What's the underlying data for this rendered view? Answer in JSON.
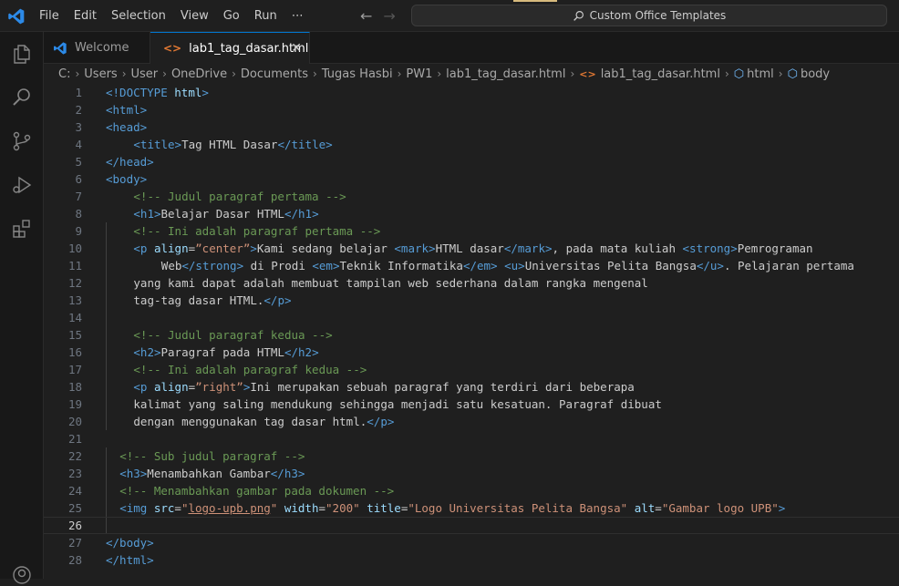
{
  "menu": [
    "File",
    "Edit",
    "Selection",
    "View",
    "Go",
    "Run",
    "⋯"
  ],
  "search": {
    "label": "Custom Office Templates"
  },
  "tabs": [
    {
      "label": "Welcome",
      "icon": "vscode-icon"
    },
    {
      "label": "lab1_tag_dasar.html",
      "icon": "html-file-icon",
      "active": true
    }
  ],
  "breadcrumb": [
    "C:",
    "Users",
    "User",
    "OneDrive",
    "Documents",
    "Tugas Hasbi",
    "PW1",
    "lab1_tag_dasar.html",
    "lab1_tag_dasar.html",
    "html",
    "body"
  ],
  "colors": {
    "tag": "#569cd6",
    "attr": "#9cdcfe",
    "string": "#ce9178",
    "comment": "#6a9955",
    "text": "#cccccc",
    "accent": "#0078d4"
  },
  "current_line": 26,
  "lines": [
    {
      "n": "1",
      "indent": 0,
      "tokens": [
        [
          "t",
          "<!DOCTYPE "
        ],
        [
          "a",
          "html"
        ],
        [
          "t",
          ">"
        ]
      ]
    },
    {
      "n": "2",
      "indent": 0,
      "tokens": [
        [
          "t",
          "<html>"
        ]
      ]
    },
    {
      "n": "3",
      "indent": 0,
      "tokens": [
        [
          "t",
          "<head>"
        ]
      ]
    },
    {
      "n": "4",
      "indent": 4,
      "tokens": [
        [
          "t",
          "<title>"
        ],
        [
          "x",
          "Tag HTML Dasar"
        ],
        [
          "t",
          "</title>"
        ]
      ]
    },
    {
      "n": "5",
      "indent": 0,
      "tokens": [
        [
          "t",
          "</head>"
        ]
      ]
    },
    {
      "n": "6",
      "indent": 0,
      "tokens": [
        [
          "t",
          "<body>"
        ]
      ]
    },
    {
      "n": "7",
      "indent": 4,
      "tokens": [
        [
          "c",
          "<!-- Judul paragraf pertama -->"
        ]
      ]
    },
    {
      "n": "8",
      "indent": 4,
      "tokens": [
        [
          "t",
          "<h1>"
        ],
        [
          "x",
          "Belajar Dasar HTML"
        ],
        [
          "t",
          "</h1>"
        ]
      ]
    },
    {
      "n": "9",
      "indent": 4,
      "tokens": [
        [
          "c",
          "<!-- Ini adalah paragraf pertama -->"
        ]
      ]
    },
    {
      "n": "10",
      "indent": 4,
      "tokens": [
        [
          "t",
          "<p "
        ],
        [
          "a",
          "align"
        ],
        [
          "x",
          "="
        ],
        [
          "s",
          "”center”"
        ],
        [
          "t",
          ">"
        ],
        [
          "x",
          "Kami sedang belajar "
        ],
        [
          "t",
          "<mark>"
        ],
        [
          "x",
          "HTML dasar"
        ],
        [
          "t",
          "</mark>"
        ],
        [
          "x",
          ", pada mata kuliah "
        ],
        [
          "t",
          "<strong>"
        ],
        [
          "x",
          "Pemrograman"
        ]
      ]
    },
    {
      "n": "11",
      "indent": 8,
      "tokens": [
        [
          "x",
          "Web"
        ],
        [
          "t",
          "</strong>"
        ],
        [
          "x",
          " di Prodi "
        ],
        [
          "t",
          "<em>"
        ],
        [
          "x",
          "Teknik Informatika"
        ],
        [
          "t",
          "</em>"
        ],
        [
          "x",
          " "
        ],
        [
          "t",
          "<u>"
        ],
        [
          "x",
          "Universitas Pelita Bangsa"
        ],
        [
          "t",
          "</u>"
        ],
        [
          "x",
          ". Pelajaran pertama"
        ]
      ]
    },
    {
      "n": "12",
      "indent": 4,
      "tokens": [
        [
          "x",
          "yang kami dapat adalah membuat tampilan web sederhana dalam rangka mengenal"
        ]
      ]
    },
    {
      "n": "13",
      "indent": 4,
      "tokens": [
        [
          "x",
          "tag-tag dasar HTML."
        ],
        [
          "t",
          "</p>"
        ]
      ]
    },
    {
      "n": "14",
      "indent": 0,
      "tokens": []
    },
    {
      "n": "15",
      "indent": 4,
      "tokens": [
        [
          "c",
          "<!-- Judul paragraf kedua -->"
        ]
      ]
    },
    {
      "n": "16",
      "indent": 4,
      "tokens": [
        [
          "t",
          "<h2>"
        ],
        [
          "x",
          "Paragraf pada HTML"
        ],
        [
          "t",
          "</h2>"
        ]
      ]
    },
    {
      "n": "17",
      "indent": 4,
      "tokens": [
        [
          "c",
          "<!-- Ini adalah paragraf kedua -->"
        ]
      ]
    },
    {
      "n": "18",
      "indent": 4,
      "tokens": [
        [
          "t",
          "<p "
        ],
        [
          "a",
          "align"
        ],
        [
          "x",
          "="
        ],
        [
          "s",
          "”right”"
        ],
        [
          "t",
          ">"
        ],
        [
          "x",
          "Ini merupakan sebuah paragraf yang terdiri dari beberapa"
        ]
      ]
    },
    {
      "n": "19",
      "indent": 4,
      "tokens": [
        [
          "x",
          "kalimat yang saling mendukung sehingga menjadi satu kesatuan. Paragraf dibuat"
        ]
      ]
    },
    {
      "n": "20",
      "indent": 4,
      "tokens": [
        [
          "x",
          "dengan menggunakan tag dasar html."
        ],
        [
          "t",
          "</p>"
        ]
      ]
    },
    {
      "n": "21",
      "indent": 0,
      "tokens": []
    },
    {
      "n": "22",
      "indent": 2,
      "tokens": [
        [
          "c",
          "<!-- Sub judul paragraf -->"
        ]
      ]
    },
    {
      "n": "23",
      "indent": 2,
      "tokens": [
        [
          "t",
          "<h3>"
        ],
        [
          "x",
          "Menambahkan Gambar"
        ],
        [
          "t",
          "</h3>"
        ]
      ]
    },
    {
      "n": "24",
      "indent": 2,
      "tokens": [
        [
          "c",
          "<!-- Menambahkan gambar pada dokumen -->"
        ]
      ]
    },
    {
      "n": "25",
      "indent": 2,
      "tokens": [
        [
          "t",
          "<img "
        ],
        [
          "a",
          "src"
        ],
        [
          "x",
          "="
        ],
        [
          "s",
          "\""
        ],
        [
          "su",
          "logo-upb.png"
        ],
        [
          "s",
          "\""
        ],
        [
          "x",
          " "
        ],
        [
          "a",
          "width"
        ],
        [
          "x",
          "="
        ],
        [
          "s",
          "\"200\""
        ],
        [
          "x",
          " "
        ],
        [
          "a",
          "title"
        ],
        [
          "x",
          "="
        ],
        [
          "s",
          "\"Logo Universitas Pelita Bangsa\""
        ],
        [
          "x",
          " "
        ],
        [
          "a",
          "alt"
        ],
        [
          "x",
          "="
        ],
        [
          "s",
          "\"Gambar logo UPB\""
        ],
        [
          "t",
          ">"
        ]
      ]
    },
    {
      "n": "26",
      "indent": 0,
      "tokens": []
    },
    {
      "n": "27",
      "indent": 0,
      "tokens": [
        [
          "t",
          "</body>"
        ]
      ]
    },
    {
      "n": "28",
      "indent": 0,
      "tokens": [
        [
          "t",
          "</html>"
        ]
      ]
    }
  ]
}
